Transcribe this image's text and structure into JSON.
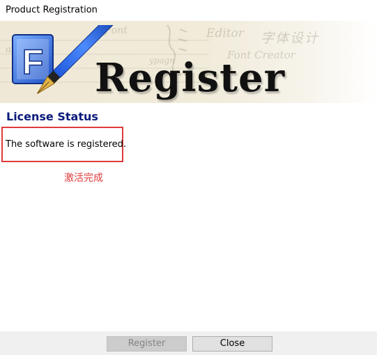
{
  "window": {
    "title": "Product Registration"
  },
  "banner": {
    "heading": "Register",
    "app_icon": "font-creator-logo-icon",
    "watermarks": {
      "editor": "Editor",
      "cjk": "字体设计",
      "font_creator": "Font Creator",
      "script1": "Ƒont",
      "script2": "ɑʀɑɡ",
      "ypagn": "ypagn"
    }
  },
  "license": {
    "section_title": "License Status",
    "status_text": "The software is registered.",
    "annotation": "激活完成",
    "annotation_color": "#e03a3a"
  },
  "footer": {
    "register_label": "Register",
    "close_label": "Close"
  },
  "colors": {
    "section_title": "#0a1a7a",
    "highlight_border": "#e03a3a",
    "footer_bg": "#f0f0f0"
  }
}
